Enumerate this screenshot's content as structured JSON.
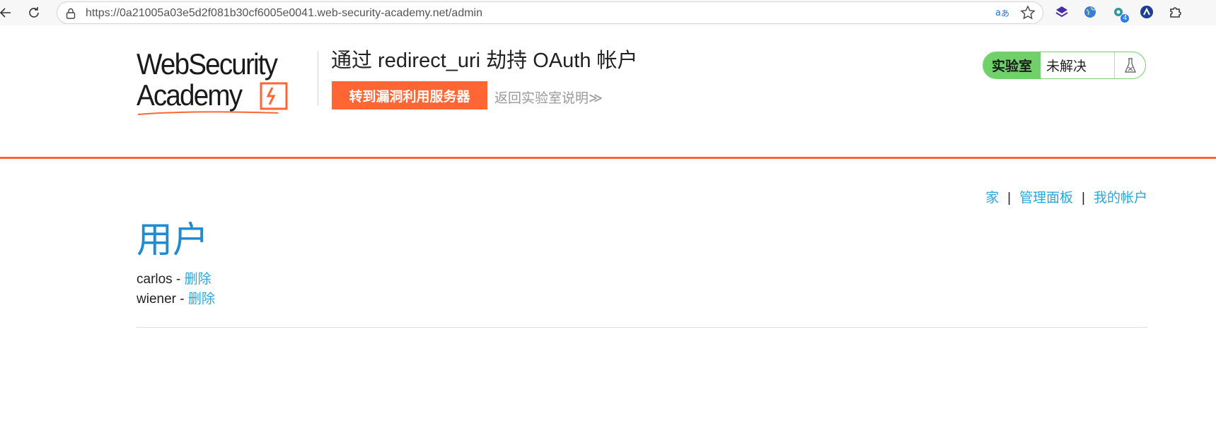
{
  "browser": {
    "url": "https://0a21005a03e5d2f081b30cf6005e0041.web-security-academy.net/admin",
    "extension_badge": "4"
  },
  "header": {
    "logo_line1": "WebSecurity",
    "logo_line2": "Academy",
    "lab_title": "通过 redirect_uri 劫持 OAuth 帐户",
    "exploit_button": "转到漏洞利用服务器",
    "back_link": "返回实验室说明",
    "back_chevron": "≫",
    "status_label": "实验室",
    "status_value": "未解决"
  },
  "nav": {
    "home": "家",
    "admin_panel": "管理面板",
    "my_account": "我的帐户",
    "separator": "|"
  },
  "page": {
    "title": "用户",
    "users": [
      {
        "name": "carlos",
        "dash": " - ",
        "action": "删除"
      },
      {
        "name": "wiener",
        "dash": " - ",
        "action": "删除"
      }
    ]
  },
  "colors": {
    "accent_orange": "#ff6633",
    "status_green": "#70d16b",
    "link_blue": "#29a8df",
    "heading_blue": "#1f8bd3"
  }
}
